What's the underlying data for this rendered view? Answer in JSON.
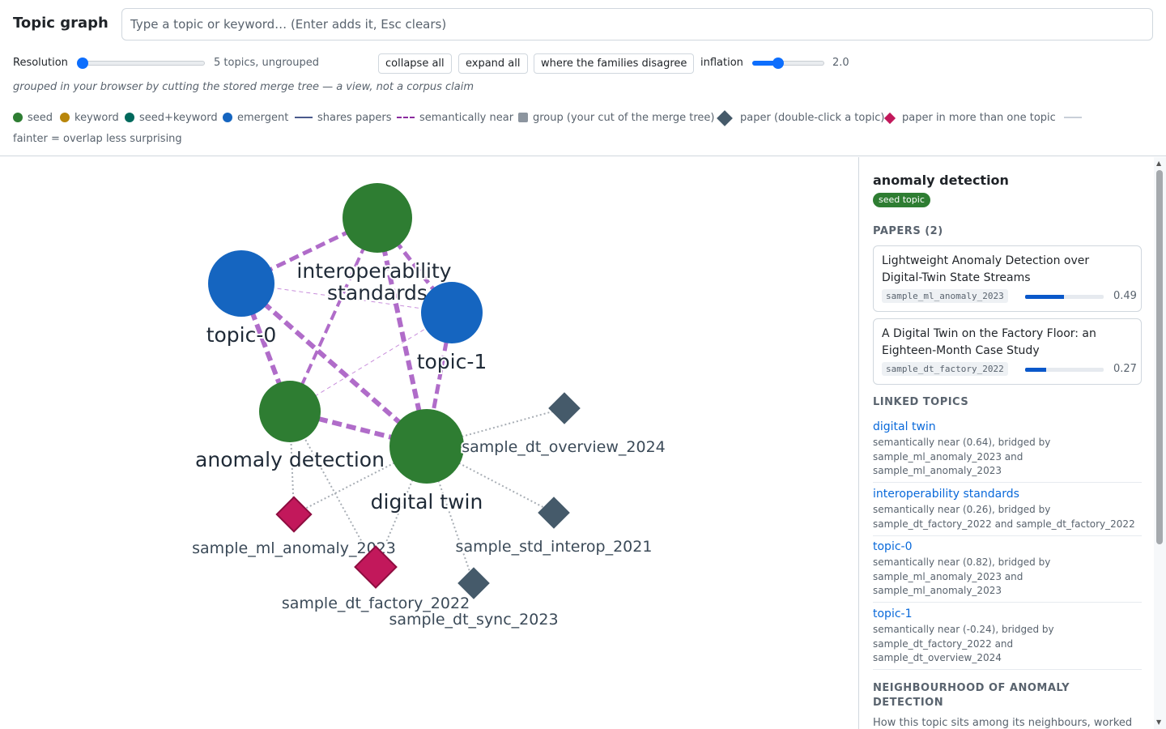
{
  "app": {
    "title": "Topic graph"
  },
  "search": {
    "placeholder": "Type a topic or keyword… (Enter adds it, Esc clears)",
    "value": ""
  },
  "controls": {
    "resolution_label": "Resolution",
    "resolution_value": 0,
    "resolution_status": "5 topics, ungrouped",
    "collapse_all": "collapse all",
    "expand_all": "expand all",
    "families_disagree": "where the families disagree",
    "inflation_label": "inflation",
    "inflation_value": "2.0",
    "inflation_fraction": 0.33
  },
  "view_note": "grouped in your browser by cutting the stored merge tree — a view, not a corpus claim",
  "legend": {
    "items": [
      {
        "label": "seed",
        "color": "#2e7d32",
        "icon": "dot"
      },
      {
        "label": "keyword",
        "color": "#b8860b",
        "icon": "dot"
      },
      {
        "label": "seed+keyword",
        "color": "#00695c",
        "icon": "dot"
      },
      {
        "label": "emergent",
        "color": "#1565c0",
        "icon": "dot"
      },
      {
        "label": "shares papers",
        "color": "#4a5a8c",
        "icon": "solid-line"
      },
      {
        "label": "semantically near",
        "color": "#8a2b9e",
        "icon": "dashed-line"
      },
      {
        "label": "group (your cut of the merge tree)",
        "color": "#8c959f",
        "icon": "square"
      },
      {
        "label": "paper (double-click a topic)",
        "color": "#455a6a",
        "icon": "diamond"
      },
      {
        "label": "paper in more than one topic",
        "color": "#c2185b",
        "icon": "diamond"
      }
    ],
    "fainter_note": "fainter = overlap less surprising"
  },
  "graph": {
    "topics": [
      {
        "id": "interop",
        "label_lines": [
          "interoperability",
          "standards"
        ],
        "kind": "seed"
      },
      {
        "id": "topic0",
        "label_lines": [
          "topic-0"
        ],
        "kind": "emergent"
      },
      {
        "id": "topic1",
        "label_lines": [
          "topic-1"
        ],
        "kind": "emergent"
      },
      {
        "id": "anomaly",
        "label_lines": [
          "anomaly detection"
        ],
        "kind": "seed"
      },
      {
        "id": "dtwin",
        "label_lines": [
          "digital twin"
        ],
        "kind": "seed"
      }
    ],
    "papers": [
      {
        "id": "p_overview",
        "label": "sample_dt_overview_2024",
        "multi": false
      },
      {
        "id": "p_interop",
        "label": "sample_std_interop_2021",
        "multi": false
      },
      {
        "id": "p_anomaly",
        "label": "sample_ml_anomaly_2023",
        "multi": true
      },
      {
        "id": "p_factory",
        "label": "sample_dt_factory_2022",
        "multi": true
      },
      {
        "id": "p_sync",
        "label": "sample_dt_sync_2023",
        "multi": false
      }
    ]
  },
  "panel": {
    "selected_title": "anomaly detection",
    "badge": "seed topic",
    "papers_heading": "PAPERS (2)",
    "papers": [
      {
        "title": "Lightweight Anomaly Detection over Digital-Twin State Streams",
        "id": "sample_ml_anomaly_2023",
        "score": "0.49",
        "score_fraction": 0.49
      },
      {
        "title": "A Digital Twin on the Factory Floor: an Eighteen-Month Case Study",
        "id": "sample_dt_factory_2022",
        "score": "0.27",
        "score_fraction": 0.27
      }
    ],
    "linked_heading": "LINKED TOPICS",
    "linked": [
      {
        "name": "digital twin",
        "desc": "semantically near (0.64), bridged by sample_ml_anomaly_2023 and sample_ml_anomaly_2023"
      },
      {
        "name": "interoperability standards",
        "desc": "semantically near (0.26), bridged by sample_dt_factory_2022 and sample_dt_factory_2022"
      },
      {
        "name": "topic-0",
        "desc": "semantically near (0.82), bridged by sample_ml_anomaly_2023 and sample_ml_anomaly_2023"
      },
      {
        "name": "topic-1",
        "desc": "semantically near (-0.24), bridged by sample_dt_factory_2022 and sample_dt_overview_2024"
      }
    ],
    "neighbourhood_heading": "NEIGHBOURHOOD OF ANOMALY DETECTION",
    "neighbourhood_desc": "How this topic sits among its neighbours, worked"
  },
  "colors": {
    "seed": "#2e7d32",
    "emergent": "#1565c0",
    "paper": "#455a6a",
    "paper_multi": "#c2185b",
    "near_edge": "#b06cc9",
    "link": "#0969da"
  }
}
